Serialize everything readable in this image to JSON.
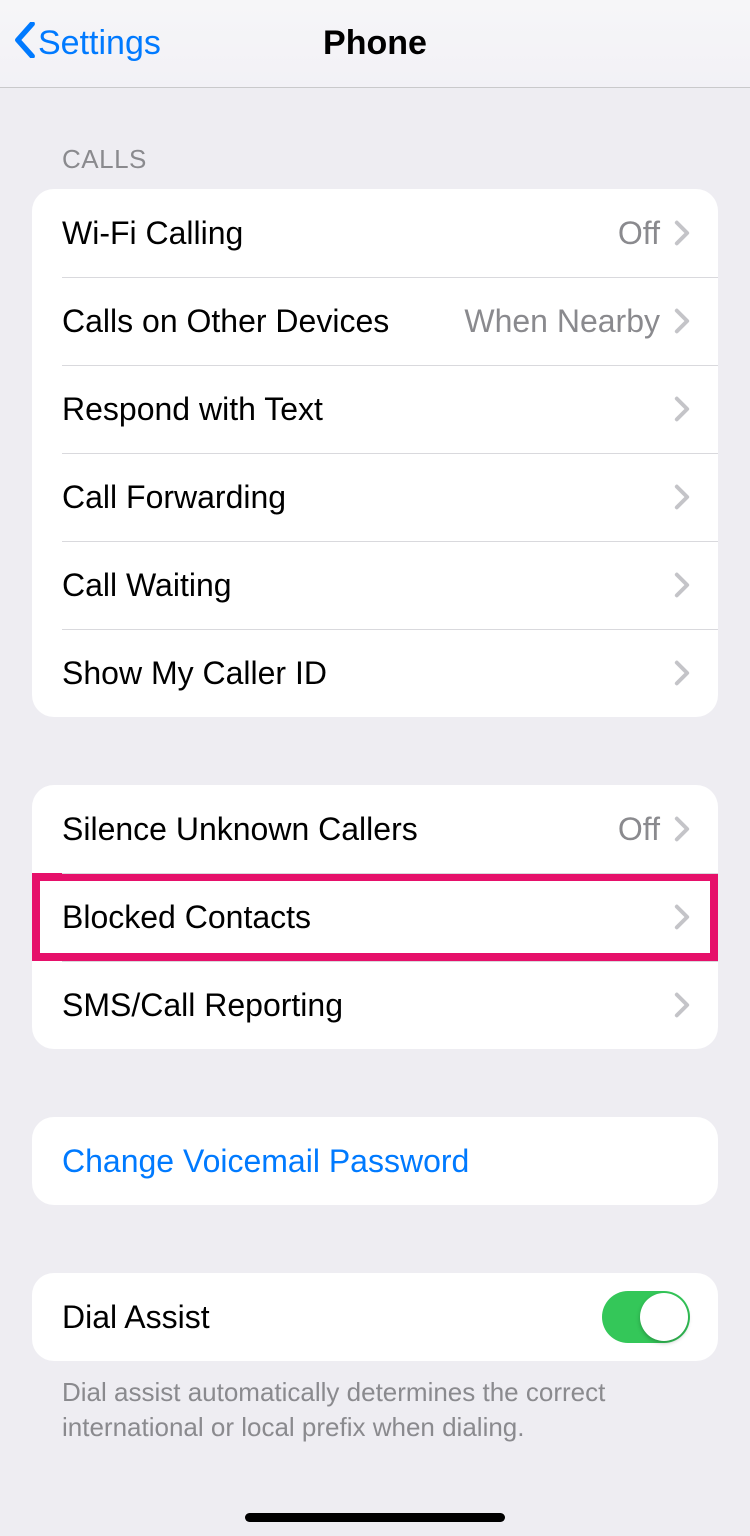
{
  "nav": {
    "back_label": "Settings",
    "title": "Phone"
  },
  "sections": {
    "calls": {
      "header": "CALLS",
      "wifi_calling": {
        "label": "Wi-Fi Calling",
        "value": "Off"
      },
      "other_devices": {
        "label": "Calls on Other Devices",
        "value": "When Nearby"
      },
      "respond_text": {
        "label": "Respond with Text"
      },
      "call_forwarding": {
        "label": "Call Forwarding"
      },
      "call_waiting": {
        "label": "Call Waiting"
      },
      "caller_id": {
        "label": "Show My Caller ID"
      }
    },
    "blocking": {
      "silence_unknown": {
        "label": "Silence Unknown Callers",
        "value": "Off"
      },
      "blocked_contacts": {
        "label": "Blocked Contacts"
      },
      "sms_reporting": {
        "label": "SMS/Call Reporting"
      }
    },
    "voicemail": {
      "change_password": {
        "label": "Change Voicemail Password"
      }
    },
    "dial_assist": {
      "label": "Dial Assist",
      "enabled": true,
      "description": "Dial assist automatically determines the correct international or local prefix when dialing."
    }
  }
}
